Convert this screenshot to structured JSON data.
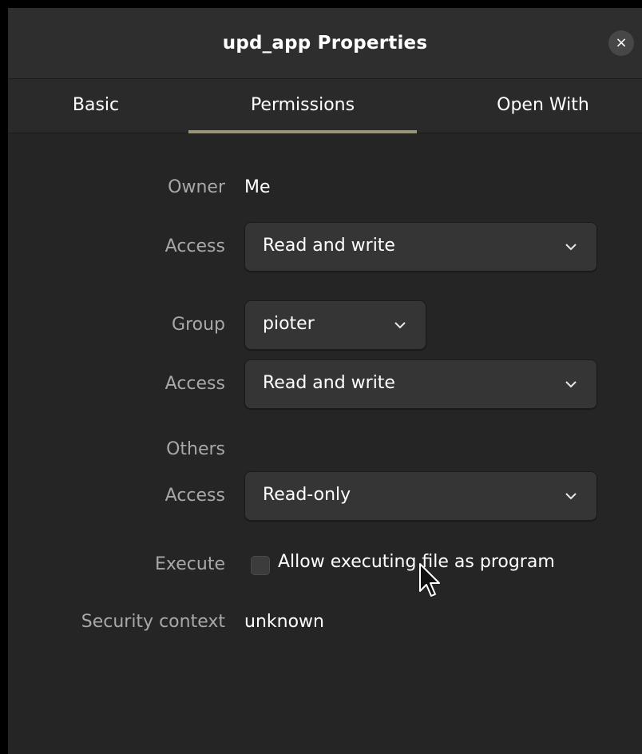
{
  "window": {
    "title": "upd_app Properties",
    "close_symbol": "×"
  },
  "tabs": [
    {
      "label": "Basic",
      "active": false
    },
    {
      "label": "Permissions",
      "active": true
    },
    {
      "label": "Open With",
      "active": false
    }
  ],
  "colors": {
    "background": "#252525",
    "titlebar": "#2e2e2e",
    "tab_indicator": "#9b9577",
    "label_text": "#a8a8a8",
    "text": "#ffffff"
  },
  "permissions": {
    "owner": {
      "label": "Owner",
      "value": "Me"
    },
    "owner_access": {
      "label": "Access",
      "selected": "Read and write"
    },
    "group": {
      "label": "Group",
      "selected": "pioter"
    },
    "group_access": {
      "label": "Access",
      "selected": "Read and write"
    },
    "others": {
      "label": "Others"
    },
    "others_access": {
      "label": "Access",
      "selected": "Read-only"
    },
    "execute": {
      "label": "Execute",
      "checkbox_label": "Allow executing file as program",
      "checked": false
    },
    "security_context": {
      "label": "Security context",
      "value": "unknown"
    }
  },
  "icons": {
    "close": "close-icon",
    "dropdown": "chevron-down-icon",
    "pointer": "mouse-pointer-icon"
  }
}
